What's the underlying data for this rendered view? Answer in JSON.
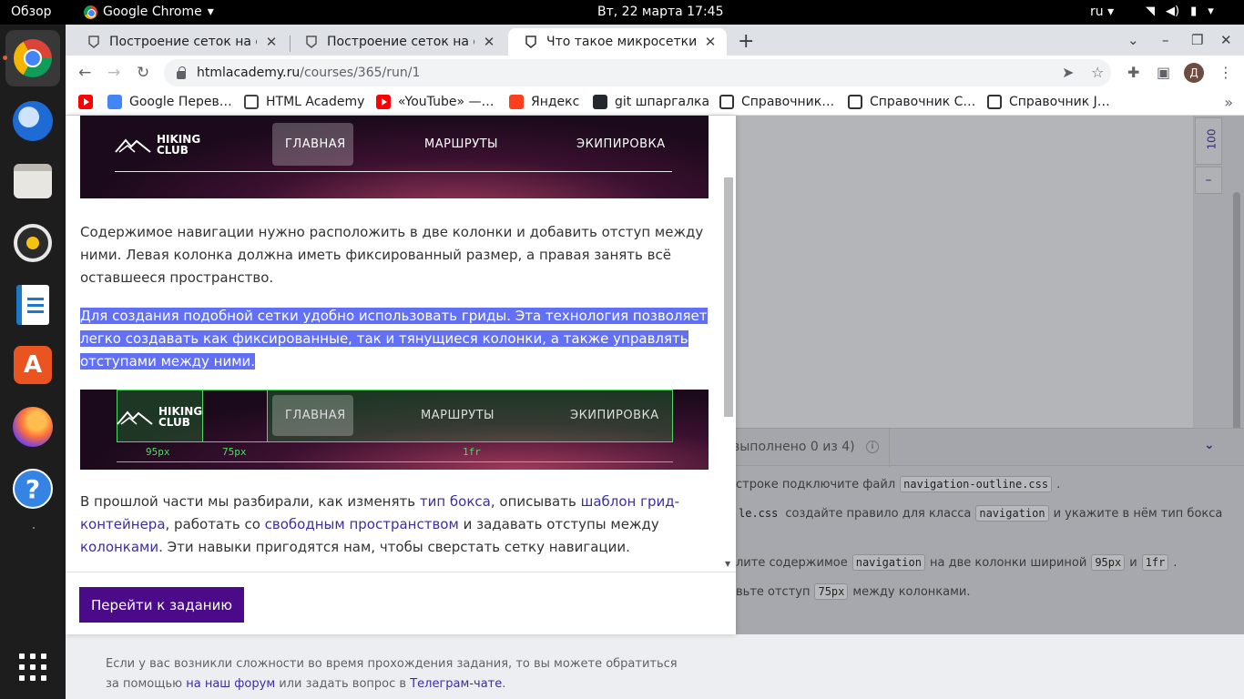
{
  "topbar": {
    "activities": "Обзор",
    "app_name": "Google Chrome",
    "clock": "Вт, 22 марта  17:45",
    "lang": "ru"
  },
  "dock": {
    "items": [
      "chrome",
      "thunderbird",
      "files",
      "rhythmbox",
      "writer",
      "software",
      "firefox",
      "help",
      "apps-grid"
    ]
  },
  "browser": {
    "tabs": [
      {
        "title": "Построение сеток на фле"
      },
      {
        "title": "Построение сеток на фле"
      },
      {
        "title": "Что такое микросетки? –"
      }
    ],
    "url_host": "htmlacademy.ru",
    "url_path": "/courses/365/run/1",
    "avatar_letter": "Д",
    "bookmarks": [
      {
        "label": "",
        "icon": "youtube-icon"
      },
      {
        "label": "Google Перев…",
        "icon": "google-translate-icon"
      },
      {
        "label": "HTML Academy",
        "icon": "htmlacademy-icon"
      },
      {
        "label": "«YouTube» —…",
        "icon": "youtube-icon"
      },
      {
        "label": "Яндекс",
        "icon": "yandex-icon"
      },
      {
        "label": "git шпаргалка",
        "icon": "github-icon"
      },
      {
        "label": "Справочник…",
        "icon": "reference-icon"
      },
      {
        "label": "Справочник С…",
        "icon": "reference-icon"
      },
      {
        "label": "Справочник J…",
        "icon": "javascript-icon"
      }
    ]
  },
  "modal": {
    "hero1": {
      "logo_top": "HIKING",
      "logo_bottom": "CLUB",
      "nav": [
        "ГЛАВНАЯ",
        "МАРШРУТЫ",
        "ЭКИПИРОВКА"
      ]
    },
    "para1": "Содержимое навигации нужно расположить в две колонки и добавить отступ между ними. Левая колонка должна иметь фиксированный размер, а правая занять всё оставшееся пространство.",
    "para2": "Для создания подобной сетки удобно использовать гриды. Эта технология позволяет легко создавать как фиксированные, так и тянущиеся колонки, а также управлять отступами между ними.",
    "hero2": {
      "logo_top": "HIKING",
      "logo_bottom": "CLUB",
      "nav": [
        "ГЛАВНАЯ",
        "МАРШРУТЫ",
        "ЭКИПИРОВКА"
      ],
      "labels": [
        "95px",
        "75px",
        "1fr"
      ]
    },
    "para3": {
      "t1": "В прошлой части мы разбирали, как изменять ",
      "l1": "тип бокса",
      "t2": ", описывать ",
      "l2": "шаблон грид-контейнера",
      "t3": ", работать со ",
      "l3": "свободным пространством",
      "t4": " и задавать отступы между ",
      "l4": "колонками",
      "t5": ". Эти навыки пригодятся нам, чтобы сверстать сетку навигации."
    },
    "button": "Перейти к заданию"
  },
  "right": {
    "zoom": "100",
    "zoom_minus": "–",
    "tasks_status": "выполнено 0 из 4)",
    "tasks": [
      {
        "parts": [
          "строке подключите файл ",
          "navigation-outline.css",
          "."
        ]
      },
      {
        "parts": [
          "le.css",
          " создайте правило для класса ",
          "navigation",
          " и укажите в нём тип бокса"
        ]
      },
      {
        "parts": [
          "лите содержимое ",
          "navigation",
          " на две колонки шириной ",
          "95px",
          " и ",
          "1fr",
          "."
        ]
      },
      {
        "parts": [
          "вьте отступ ",
          "75px",
          " между колонками."
        ]
      }
    ]
  },
  "help": {
    "line1": "Если у вас возникли сложности во время прохождения задания, то вы можете обратиться",
    "line2_a": "за помощью ",
    "link1": "на наш форум",
    "line2_b": " или задать вопрос в ",
    "link2": "Телеграм-чате",
    "line2_c": "."
  }
}
